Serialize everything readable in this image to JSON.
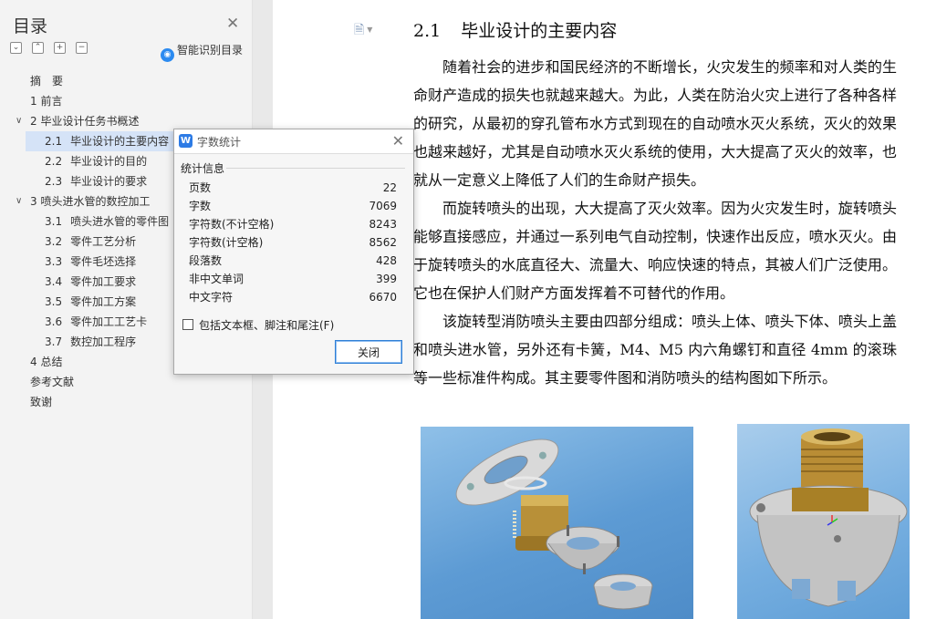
{
  "toc": {
    "title": "目录",
    "smart_label": "智能识别目录",
    "items": [
      {
        "num": "",
        "label": "摘　要"
      },
      {
        "num": "",
        "label": "1 前言"
      },
      {
        "num": "",
        "label": "2 毕业设计任务书概述"
      },
      {
        "num": "2.1",
        "label": "毕业设计的主要内容"
      },
      {
        "num": "2.2",
        "label": "毕业设计的目的"
      },
      {
        "num": "2.3",
        "label": "毕业设计的要求"
      },
      {
        "num": "",
        "label": "3 喷头进水管的数控加工"
      },
      {
        "num": "3.1",
        "label": "喷头进水管的零件图"
      },
      {
        "num": "3.2",
        "label": "零件工艺分析"
      },
      {
        "num": "3.3",
        "label": "零件毛坯选择"
      },
      {
        "num": "3.4",
        "label": "零件加工要求"
      },
      {
        "num": "3.5",
        "label": "零件加工方案"
      },
      {
        "num": "3.6",
        "label": "零件加工工艺卡"
      },
      {
        "num": "3.7",
        "label": "数控加工程序"
      },
      {
        "num": "",
        "label": "4 总结"
      },
      {
        "num": "",
        "label": "参考文献"
      },
      {
        "num": "",
        "label": "致谢"
      }
    ]
  },
  "document": {
    "heading_num": "2.1",
    "heading_text": "毕业设计的主要内容",
    "paragraphs": [
      "随着社会的进步和国民经济的不断增长，火灾发生的频率和对人类的生命财产造成的损失也就越来越大。为此，人类在防治火灾上进行了各种各样的研究，从最初的穿孔管布水方式到现在的自动喷水灭火系统，灭火的效果也越来越好，尤其是自动喷水灭火系统的使用，大大提高了灭火的效率，也就从一定意义上降低了人们的生命财产损失。",
      "而旋转喷头的出现，大大提高了灭火效率。因为火灾发生时，旋转喷头能够直接感应，并通过一系列电气自动控制，快速作出反应，喷水灭火。由于旋转喷头的水底直径大、流量大、响应快速的特点，其被人们广泛使用。它也在保护人们财产方面发挥着不可替代的作用。",
      "该旋转型消防喷头主要由四部分组成：喷头上体、喷头下体、喷头上盖和喷头进水管，另外还有卡簧，M4、M5 内六角螺钉和直径 4mm 的滚珠等一些标准件构成。其主要零件图和消防喷头的结构图如下所示。"
    ]
  },
  "word_count": {
    "title": "字数统计",
    "group_label": "统计信息",
    "stats": [
      {
        "label": "页数",
        "value": "22"
      },
      {
        "label": "字数",
        "value": "7069"
      },
      {
        "label": "字符数(不计空格)",
        "value": "8243"
      },
      {
        "label": "字符数(计空格)",
        "value": "8562"
      },
      {
        "label": "段落数",
        "value": "428"
      },
      {
        "label": "非中文单词",
        "value": "399"
      },
      {
        "label": "中文字符",
        "value": "6670"
      }
    ],
    "checkbox_label": "包括文本框、脚注和尾注(F)",
    "checkbox_checked": false,
    "close_label": "关闭"
  },
  "colors": {
    "accent": "#2d7be5",
    "toc_active_bg": "#d5e3f7"
  }
}
